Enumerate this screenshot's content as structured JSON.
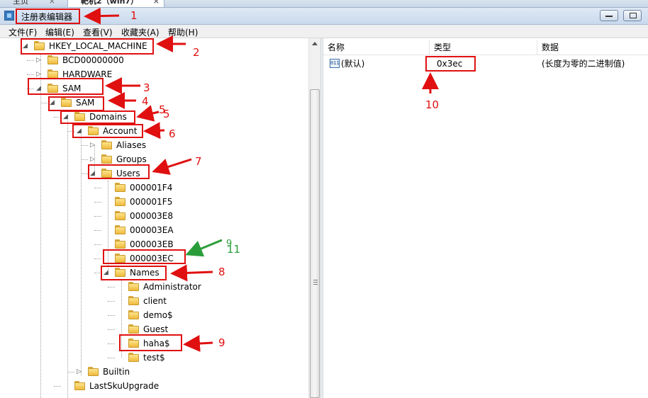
{
  "tabs": [
    {
      "label": "主页",
      "close": "×"
    },
    {
      "label": "靶机2（win7）",
      "close": "×"
    }
  ],
  "window": {
    "title": "注册表编辑器",
    "title_annotation": "1"
  },
  "menu": [
    "文件(F)",
    "编辑(E)",
    "查看(V)",
    "收藏夹(A)",
    "帮助(H)"
  ],
  "tree": [
    {
      "label": "HKEY_LOCAL_MACHINE",
      "annotation": "2"
    },
    {
      "label": "BCD00000000"
    },
    {
      "label": "HARDWARE"
    },
    {
      "label": "SAM",
      "annotation": "3"
    },
    {
      "label": "SAM",
      "annotation": "4"
    },
    {
      "label": "Domains",
      "annotation": "5"
    },
    {
      "label": "Account",
      "annotation": "6"
    },
    {
      "label": "Aliases"
    },
    {
      "label": "Groups"
    },
    {
      "label": "Users",
      "annotation": "7"
    },
    {
      "label": "000001F4"
    },
    {
      "label": "000001F5"
    },
    {
      "label": "000003E8"
    },
    {
      "label": "000003EA"
    },
    {
      "label": "000003EB"
    },
    {
      "label": "000003EC",
      "annotation": "11"
    },
    {
      "label": "Names",
      "annotation": "8"
    },
    {
      "label": "Administrator"
    },
    {
      "label": "client"
    },
    {
      "label": "demo$"
    },
    {
      "label": "Guest"
    },
    {
      "label": "haha$",
      "annotation": "9"
    },
    {
      "label": "test$"
    },
    {
      "label": "Builtin"
    },
    {
      "label": "LastSkuUpgrade"
    }
  ],
  "annotation_extra": {
    "domains_label": "5",
    "green_label": "9"
  },
  "list": {
    "columns": [
      "名称",
      "类型",
      "数据"
    ],
    "rows": [
      {
        "name": "(默认)",
        "type": "0x3ec",
        "data": "(长度为零的二进制值)",
        "icon": "binary-value-icon",
        "annotation": "10"
      }
    ]
  },
  "colors": {
    "annotation_red": "#e01010",
    "annotation_green": "#2a9d3a",
    "folder_yellow": "#f2c64a"
  }
}
